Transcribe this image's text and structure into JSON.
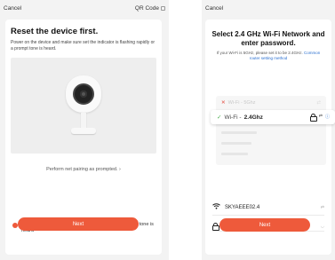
{
  "left": {
    "cancel": "Cancel",
    "qr_code": "QR Code",
    "title": "Reset the device first.",
    "description": "Power on the device and make sure set the indicator is flashing rapidly or a prompt tone is heard.",
    "net_pairing_link": "Perform net pairing as prompted. ›",
    "confirm_text": "Make sure the indicator is flashing quickly or a prompt tone is heard",
    "next": "Next"
  },
  "right": {
    "cancel": "Cancel",
    "title": "Select 2.4 GHz Wi-Fi Network and enter password.",
    "description": "If your Wi-Fi is 5GHz, please set it to be 2.4GHz.",
    "router_link": "Common router setting method",
    "wifi_5g_label": "Wi-Fi - 5Ghz",
    "wifi_24_prefix": "Wi-Fi - ",
    "wifi_24_band": "2.4Ghz",
    "ssid": "SKYAEEE02.4",
    "password_value": "",
    "next": "Next"
  },
  "icons": {
    "cross": "✕",
    "check": "✓",
    "wifi": "📶",
    "info": "ⓘ",
    "switch": "⇄",
    "eye": "◡",
    "lock": "🔒"
  },
  "colors": {
    "accent": "#ee5a3b",
    "link": "#2a6fcf",
    "success": "#4caf50"
  }
}
